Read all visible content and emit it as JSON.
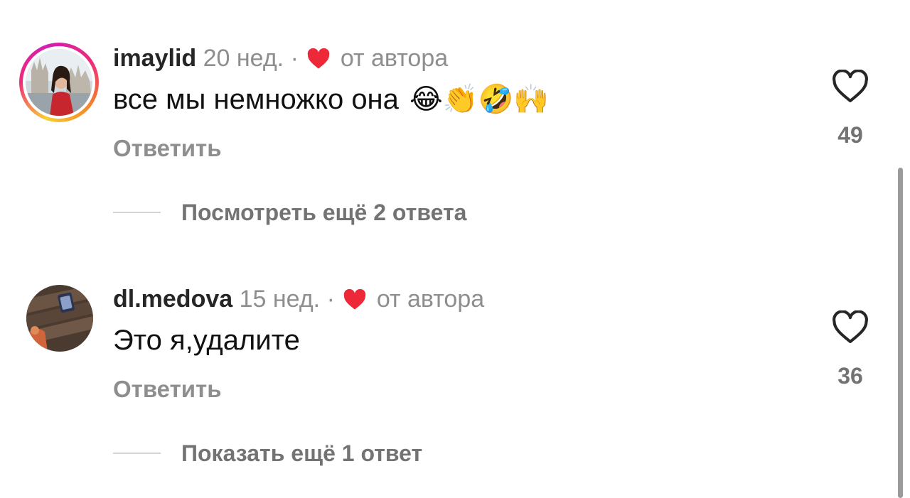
{
  "comments": [
    {
      "username": "imaylid",
      "time": "20 нед.",
      "separator": "·",
      "author_liked_label": "от автора",
      "text": "все мы немножко она",
      "emojis": "😂👏🤣🙌",
      "reply_label": "Ответить",
      "likes": "49",
      "more_replies_label": "Посмотреть ещё 2 ответа",
      "has_story_ring": true
    },
    {
      "username": "dl.medova",
      "time": "15 нед.",
      "separator": "·",
      "author_liked_label": "от автора",
      "text": "Это я,удалите",
      "emojis": "",
      "reply_label": "Ответить",
      "likes": "36",
      "more_replies_label": "Показать ещё 1 ответ",
      "has_story_ring": false
    }
  ],
  "colors": {
    "heart_red": "#ed2839",
    "muted_text": "#8e8e8e",
    "username": "#262626"
  },
  "icons": {
    "like": "heart-outline-icon",
    "author_like": "heart-filled-icon"
  }
}
